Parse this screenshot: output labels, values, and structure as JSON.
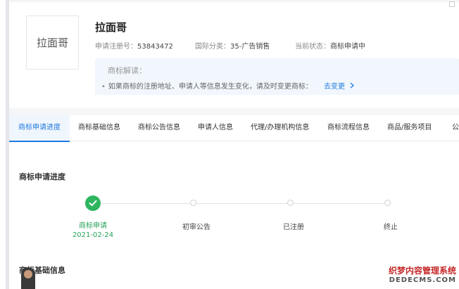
{
  "trademark": {
    "logo_text": "拉面哥",
    "name": "拉面哥",
    "reg_no_label": "申请注册号：",
    "reg_no": "53843472",
    "class_label": "国际分类：",
    "class_value": "35-广告销售",
    "status_label": "当前状态：",
    "status_value": "商标申请中"
  },
  "interpretation": {
    "title": "商标解读：",
    "text": "如果商标的注册地址、申请人等信息发生变化，请及时变更商标：",
    "link": "去变更"
  },
  "tabs": [
    {
      "label": "商标申请进度",
      "active": true
    },
    {
      "label": "商标基础信息"
    },
    {
      "label": "商标公告信息"
    },
    {
      "label": "申请人信息"
    },
    {
      "label": "代理/办理机构信息"
    },
    {
      "label": "商标流程信息"
    },
    {
      "label": "商品/服务项目"
    },
    {
      "label": "公"
    }
  ],
  "progress": {
    "title": "商标申请进度",
    "steps": [
      {
        "label": "商标申请",
        "date": "2021-02-24",
        "done": true
      },
      {
        "label": "初审公告",
        "done": false
      },
      {
        "label": "已注册",
        "done": false
      },
      {
        "label": "终止",
        "done": false
      }
    ]
  },
  "next_section_title": "商标基础信息",
  "watermark": {
    "line1": "织梦内容管理系统",
    "line2": "DEDECMS.COM"
  },
  "colors": {
    "accent": "#1f7ae0",
    "success": "#2db560"
  }
}
